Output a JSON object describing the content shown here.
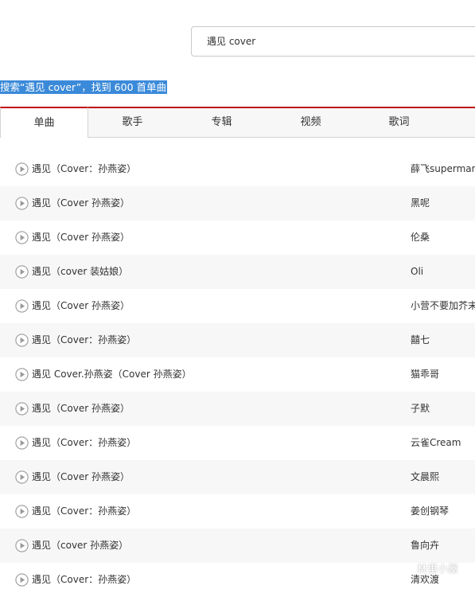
{
  "search": {
    "value": "遇见 cover"
  },
  "result_summary": "搜索“遇见 cover”，找到 600 首单曲",
  "tabs": [
    {
      "label": "单曲",
      "active": true
    },
    {
      "label": "歌手",
      "active": false
    },
    {
      "label": "专辑",
      "active": false
    },
    {
      "label": "视频",
      "active": false
    },
    {
      "label": "歌词",
      "active": false
    }
  ],
  "songs": [
    {
      "title": "遇见（Cover：孙燕姿）",
      "artist": "薛飞superman"
    },
    {
      "title": "遇见（Cover 孙燕姿）",
      "artist": "黑呢"
    },
    {
      "title": "遇见（Cover 孙燕姿）",
      "artist": "伦桑"
    },
    {
      "title": "遇见（cover 装姑娘）",
      "artist": "Oli"
    },
    {
      "title": "遇见（Cover 孙燕姿）",
      "artist": "小营不要加芥末"
    },
    {
      "title": "遇见（Cover：孙燕姿）",
      "artist": "囍七"
    },
    {
      "title": "遇见 Cover.孙燕姿（Cover 孙燕姿）",
      "artist": "猫乖哥"
    },
    {
      "title": "遇见（Cover 孙燕姿）",
      "artist": "子默"
    },
    {
      "title": "遇见（Cover：孙燕姿）",
      "artist": "云雀Cream"
    },
    {
      "title": "遇见（Cover 孙燕姿）",
      "artist": "文晨熙"
    },
    {
      "title": "遇见（Cover：孙燕姿）",
      "artist": "姜创钢琴"
    },
    {
      "title": "遇见（cover 孙燕姿）",
      "artist": "鲁向卉"
    },
    {
      "title": "遇见（Cover：孙燕姿）",
      "artist": "清欢渡"
    }
  ],
  "watermark": "林里小屋",
  "colors": {
    "accent": "#c20c0c",
    "selection": "#3b8ad9",
    "row_alt": "#f7f7f7"
  },
  "icons": {
    "play": "play-circle-icon",
    "watermark": "wechat-icon"
  }
}
